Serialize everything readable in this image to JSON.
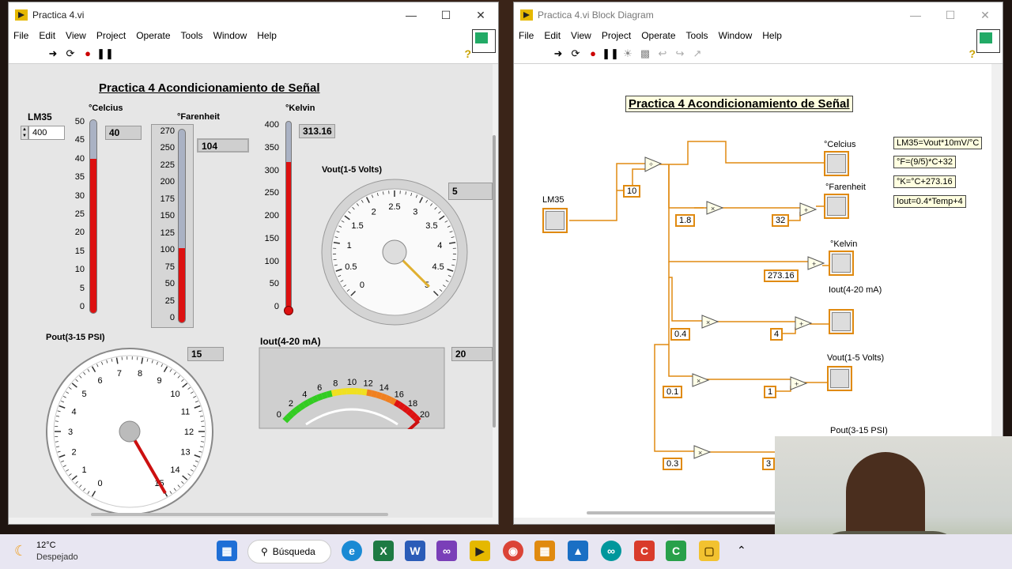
{
  "front_panel": {
    "title": "Practica 4.vi",
    "menu": [
      "File",
      "Edit",
      "View",
      "Project",
      "Operate",
      "Tools",
      "Window",
      "Help"
    ],
    "heading": "Practica 4 Acondicionamiento de Señal",
    "lm35": {
      "label": "LM35",
      "value": "400"
    },
    "celcius": {
      "label": "°Celcius",
      "value": "40",
      "scale": [
        "50",
        "45",
        "40",
        "35",
        "30",
        "25",
        "20",
        "15",
        "10",
        "5",
        "0"
      ],
      "level": 40,
      "max": 50
    },
    "farenheit": {
      "label": "°Farenheit",
      "value": "104",
      "scale": [
        "270",
        "250",
        "225",
        "200",
        "175",
        "150",
        "125",
        "100",
        "75",
        "50",
        "25",
        "0"
      ],
      "level": 104,
      "max": 270
    },
    "kelvin": {
      "label": "°Kelvin",
      "value": "313.16",
      "scale": [
        "400",
        "350",
        "300",
        "250",
        "200",
        "150",
        "100",
        "50",
        "0"
      ],
      "level": 313.16,
      "max": 400
    },
    "vout": {
      "label": "Vout(1-5 Volts)",
      "value": "5",
      "scale": [
        "0",
        "0.5",
        "1",
        "1.5",
        "2",
        "2.5",
        "3",
        "3.5",
        "4",
        "4.5",
        "5"
      ]
    },
    "pout": {
      "label": "Pout(3-15 PSI)",
      "value": "15",
      "scale": [
        "0",
        "1",
        "2",
        "3",
        "4",
        "5",
        "6",
        "7",
        "8",
        "9",
        "10",
        "11",
        "12",
        "13",
        "14",
        "15"
      ]
    },
    "iout": {
      "label": "Iout(4-20 mA)",
      "value": "20",
      "scale": [
        "0",
        "2",
        "4",
        "6",
        "8",
        "10",
        "12",
        "14",
        "16",
        "18",
        "20"
      ]
    }
  },
  "block_diagram": {
    "title": "Practica 4.vi Block Diagram",
    "menu": [
      "File",
      "Edit",
      "View",
      "Project",
      "Operate",
      "Tools",
      "Window",
      "Help"
    ],
    "heading": "Practica 4 Acondicionamiento de Señal",
    "comments": [
      "LM35=Vout*10mV/°C",
      "°F=(9/5)*C+32",
      "°K=°C+273.16",
      "Iout=0.4*Temp+4"
    ],
    "constants": [
      "10",
      "1.8",
      "32",
      "273.16",
      "0.4",
      "4",
      "0.1",
      "1",
      "0.3",
      "3"
    ],
    "labels": {
      "lm35": "LM35",
      "celcius": "°Celcius",
      "farenheit": "°Farenheit",
      "kelvin": "°Kelvin",
      "iout": "Iout(4-20 mA)",
      "vout": "Vout(1-5 Volts)",
      "pout": "Pout(3-15 PSI)"
    }
  },
  "taskbar": {
    "weather_temp": "12°C",
    "weather_desc": "Despejado",
    "search": "Búsqueda"
  }
}
